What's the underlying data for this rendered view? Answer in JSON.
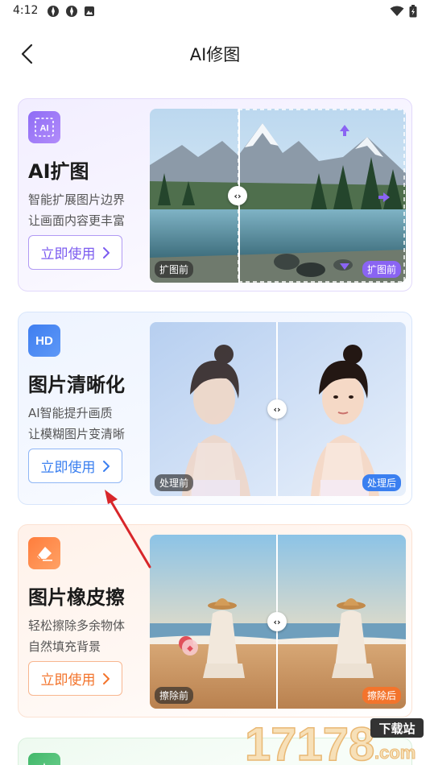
{
  "status_bar": {
    "time": "4:12"
  },
  "header": {
    "title": "AI修图"
  },
  "cards": [
    {
      "icon": "ai-expand-icon",
      "icon_text": "AI",
      "title": "AI扩图",
      "desc_line1": "智能扩展图片边界",
      "desc_line2": "让画面内容更丰富",
      "button_label": "立即使用",
      "tag_before": "扩图前",
      "tag_after": "扩图前",
      "accent": "#7c5cf0"
    },
    {
      "icon": "hd-icon",
      "icon_text": "HD",
      "title": "图片清晰化",
      "desc_line1": "AI智能提升画质",
      "desc_line2": "让模糊图片变清晰",
      "button_label": "立即使用",
      "tag_before": "处理前",
      "tag_after": "处理后",
      "accent": "#3a7ff0"
    },
    {
      "icon": "eraser-icon",
      "title": "图片橡皮擦",
      "desc_line1": "轻松擦除多余物体",
      "desc_line2": "自然填充背景",
      "button_label": "立即使用",
      "tag_before": "擦除前",
      "tag_after": "擦除后",
      "accent": "#f3742c"
    }
  ],
  "watermark": {
    "number": "17178",
    "tld": ".com",
    "label": "下载站"
  }
}
